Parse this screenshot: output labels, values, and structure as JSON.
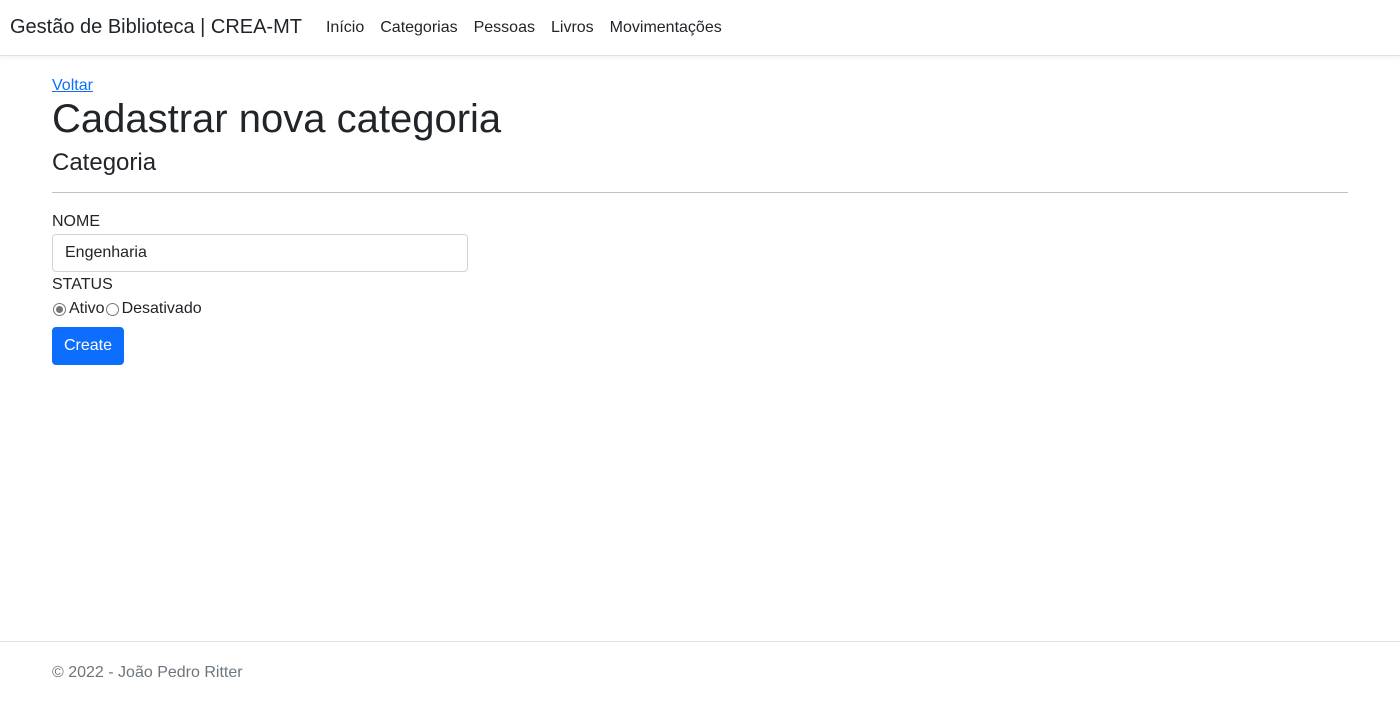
{
  "navbar": {
    "brand": "Gestão de Biblioteca | CREA-MT",
    "items": [
      {
        "label": "Início"
      },
      {
        "label": "Categorias"
      },
      {
        "label": "Pessoas"
      },
      {
        "label": "Livros"
      },
      {
        "label": "Movimentações"
      }
    ]
  },
  "main": {
    "back_link": "Voltar",
    "title": "Cadastrar nova categoria",
    "subtitle": "Categoria",
    "form": {
      "name_label": "NOME",
      "name_value": "Engenharia",
      "status_label": "STATUS",
      "status_options": [
        {
          "label": "Ativo",
          "checked": true
        },
        {
          "label": "Desativado",
          "checked": false
        }
      ],
      "submit_label": "Create"
    }
  },
  "footer": {
    "text": "© 2022 - João Pedro Ritter"
  },
  "colors": {
    "primary": "#0d6efd",
    "text": "#212529",
    "muted": "#6c757d"
  }
}
